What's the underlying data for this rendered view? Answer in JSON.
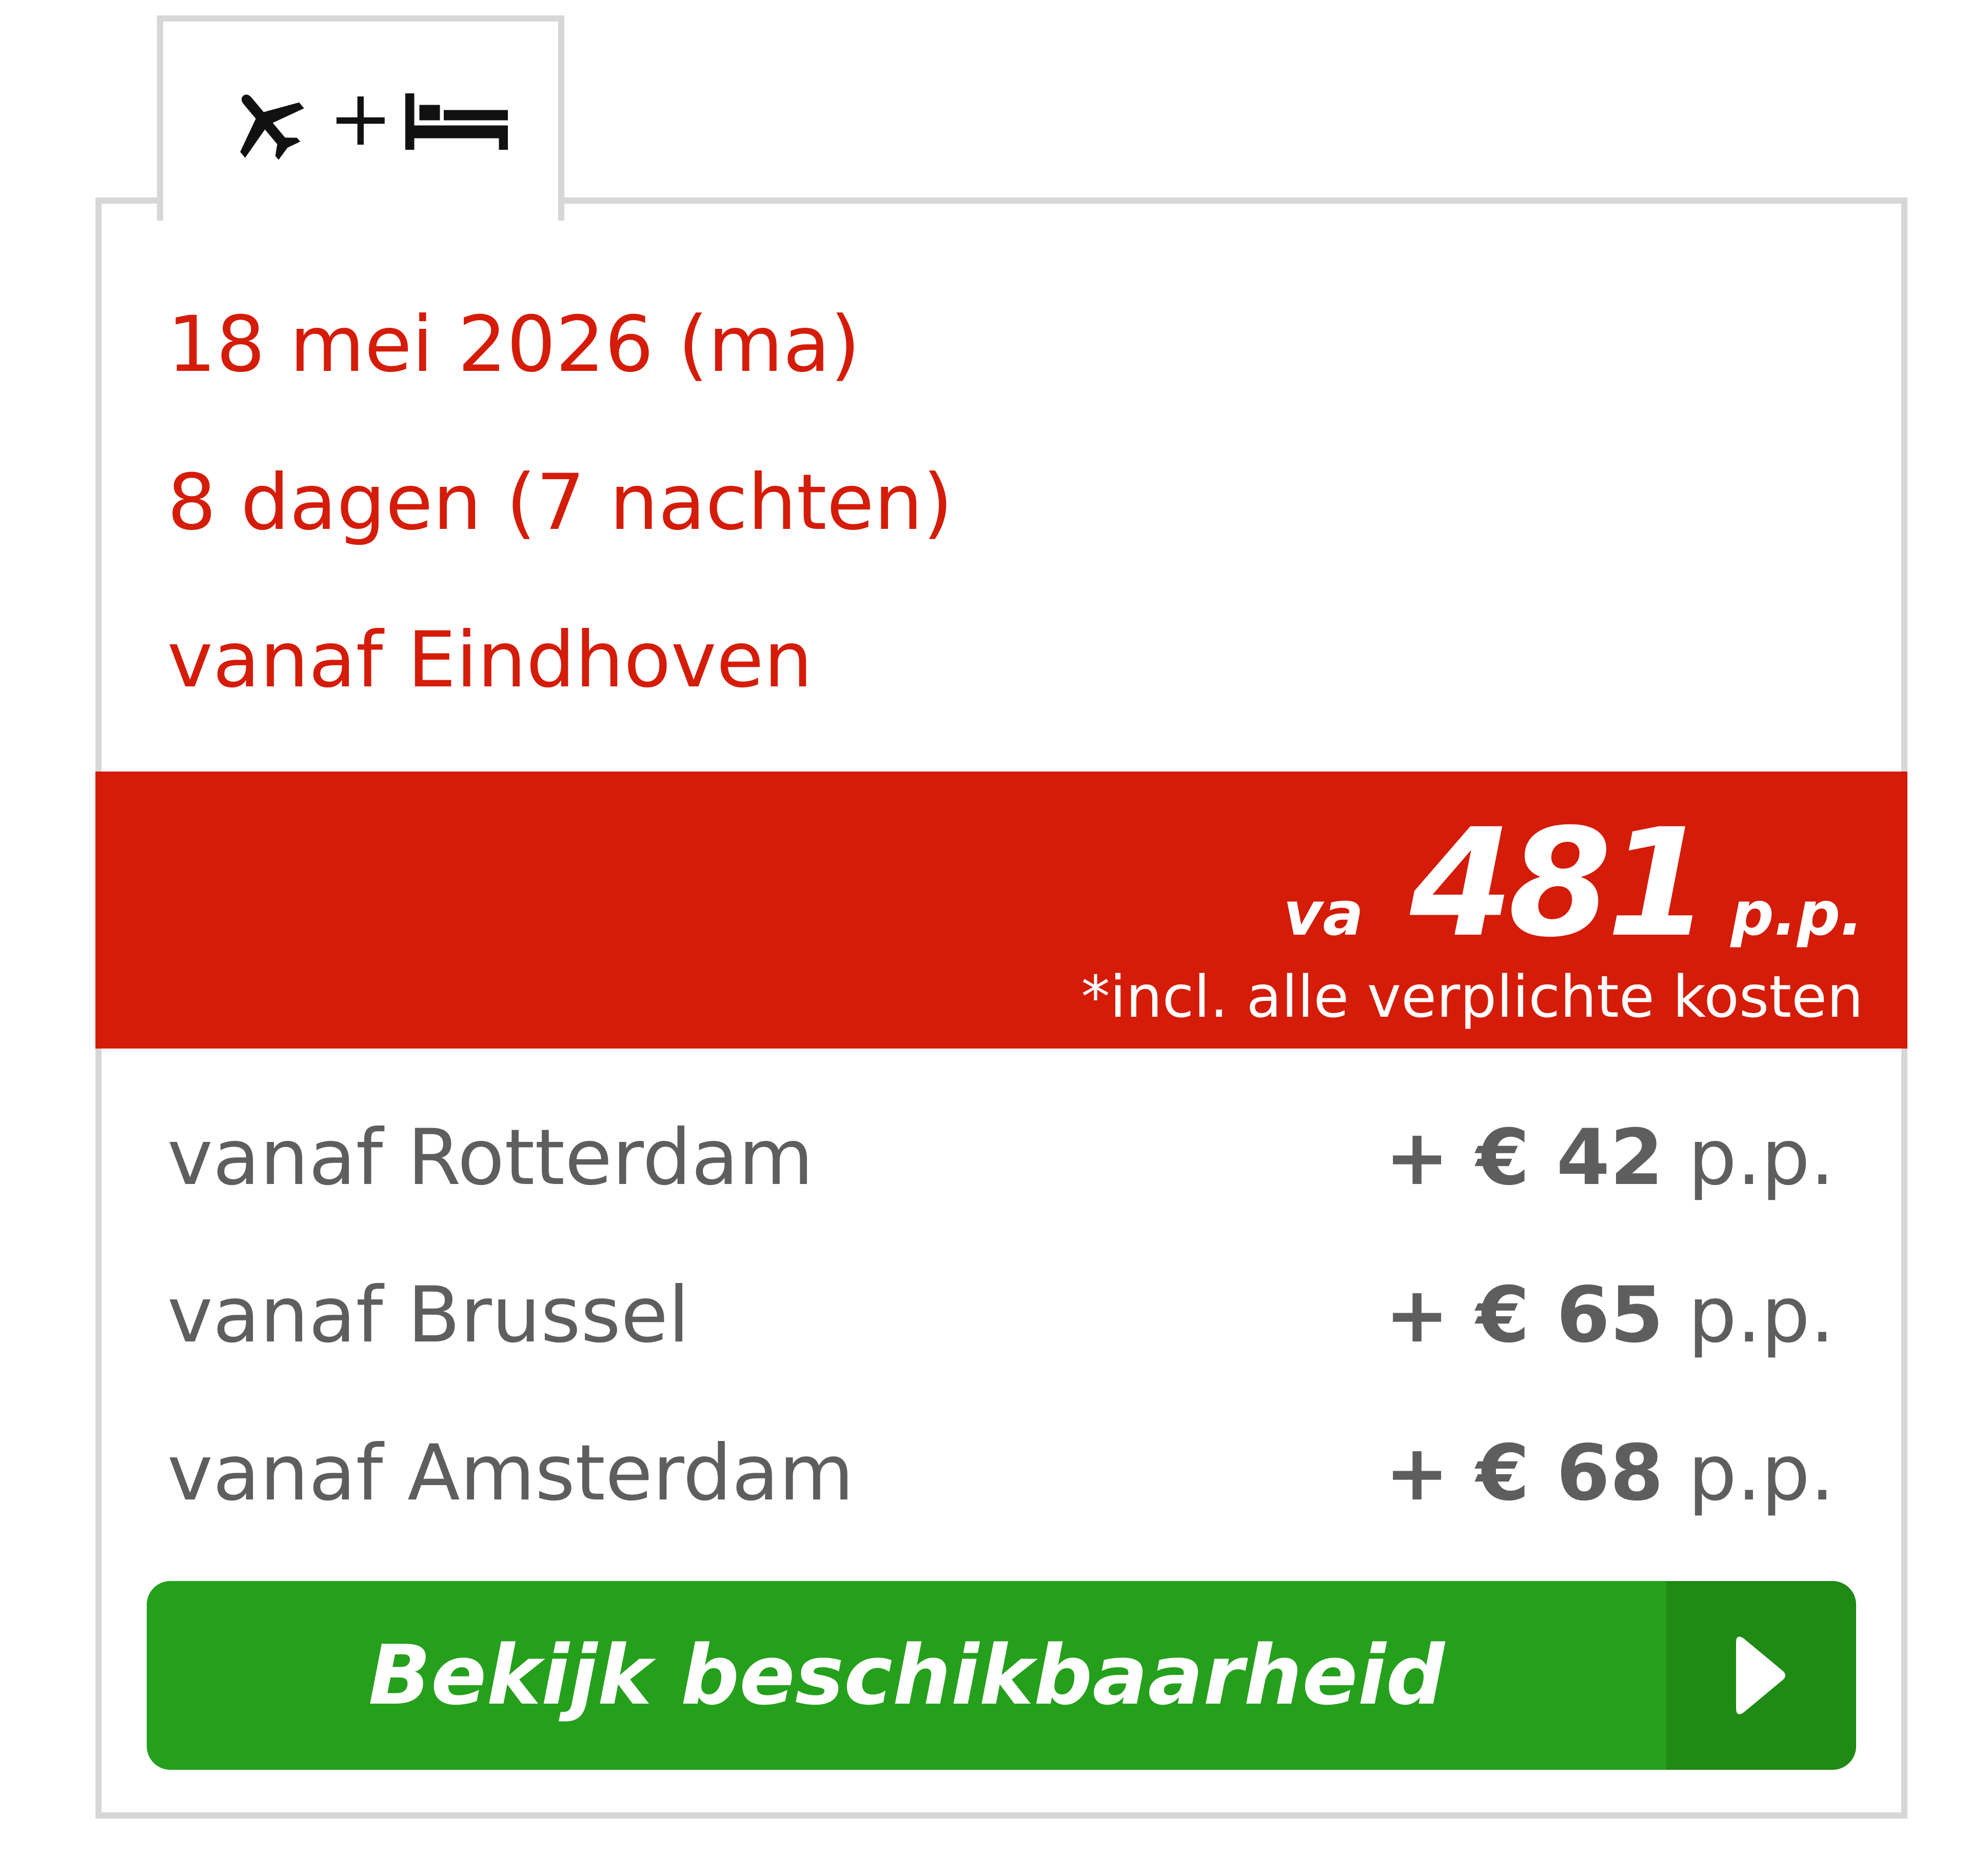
{
  "tab": {
    "icons": [
      "airplane-icon",
      "plus-icon",
      "bed-icon"
    ],
    "plus": "+"
  },
  "trip": {
    "date": "18 mei 2026 (ma)",
    "duration": "8 dagen (7 nachten)",
    "departure": "vanaf Eindhoven"
  },
  "price": {
    "prefix": "va",
    "amount": "481",
    "suffix": "p.p.",
    "note": "*incl. alle verplichte kosten"
  },
  "alternatives": [
    {
      "label": "vanaf Rotterdam",
      "plus": "+ € 42",
      "unit": "p.p."
    },
    {
      "label": "vanaf Brussel",
      "plus": "+ € 65",
      "unit": "p.p."
    },
    {
      "label": "vanaf Amsterdam",
      "plus": "+ € 68",
      "unit": "p.p."
    }
  ],
  "cta": {
    "label": "Bekijk beschikbaarheid",
    "icon": "play-arrow-icon"
  },
  "colors": {
    "accent_red": "#d41c09",
    "cta_green": "#25a01c",
    "cta_green_dark": "#1f8a14",
    "muted_text": "#5e5e5e",
    "border": "#d7d7d7"
  }
}
